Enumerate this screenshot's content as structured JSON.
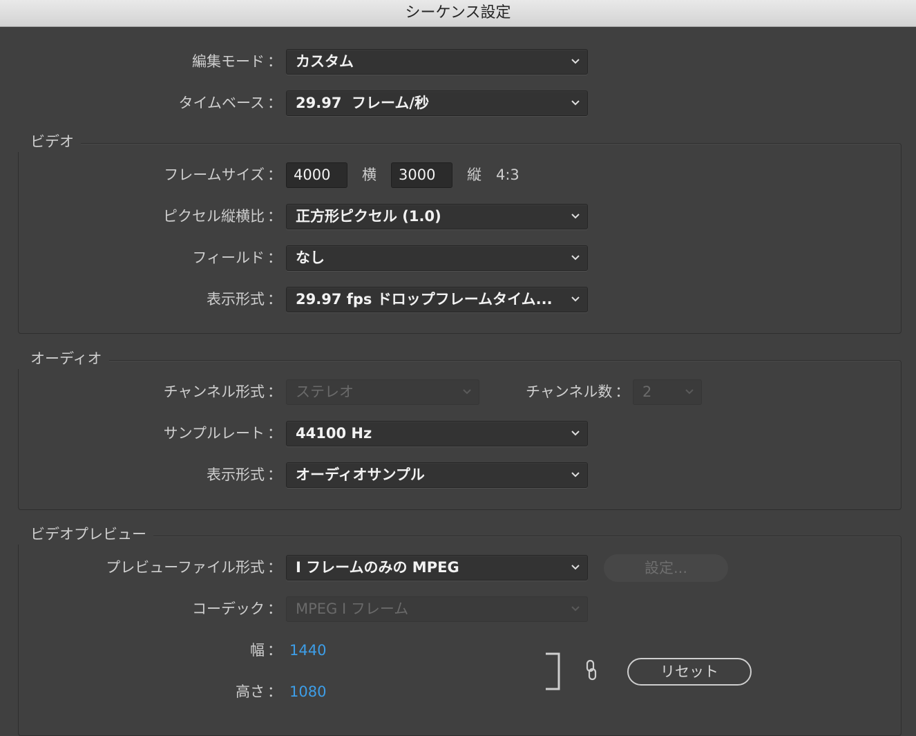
{
  "window": {
    "title": "シーケンス設定"
  },
  "general": {
    "edit_mode": {
      "label": "編集モード",
      "value": "カスタム"
    },
    "timebase": {
      "label": "タイムベース",
      "value": "29.97  フレーム/秒"
    }
  },
  "video": {
    "group_title": "ビデオ",
    "frame_size": {
      "label": "フレームサイズ",
      "width": "4000",
      "width_label": "横",
      "height": "3000",
      "height_label": "縦",
      "aspect": "4:3"
    },
    "pixel_aspect": {
      "label": "ピクセル縦横比",
      "value": "正方形ピクセル (1.0)"
    },
    "fields": {
      "label": "フィールド",
      "value": "なし"
    },
    "display_format": {
      "label": "表示形式",
      "value": "29.97 fps ドロップフレームタイム..."
    }
  },
  "audio": {
    "group_title": "オーディオ",
    "channel_format": {
      "label": "チャンネル形式",
      "value": "ステレオ"
    },
    "channel_count": {
      "label": "チャンネル数",
      "value": "2"
    },
    "sample_rate": {
      "label": "サンプルレート",
      "value": "44100 Hz"
    },
    "display_format": {
      "label": "表示形式",
      "value": "オーディオサンプル"
    }
  },
  "preview": {
    "group_title": "ビデオプレビュー",
    "file_format": {
      "label": "プレビューファイル形式",
      "value": "I フレームのみの MPEG"
    },
    "settings_button": "設定...",
    "codec": {
      "label": "コーデック",
      "value": "MPEG I フレーム"
    },
    "width": {
      "label": "幅",
      "value": "1440"
    },
    "height": {
      "label": "高さ",
      "value": "1080"
    },
    "reset_button": "リセット"
  },
  "colon": "：",
  "icons": [
    "chevron-down-icon",
    "link-icon",
    "bracket-icon"
  ],
  "colors": {
    "background": "#404040",
    "accent_blue": "#3d9ee8",
    "titlebar": "#dcdcdc"
  }
}
